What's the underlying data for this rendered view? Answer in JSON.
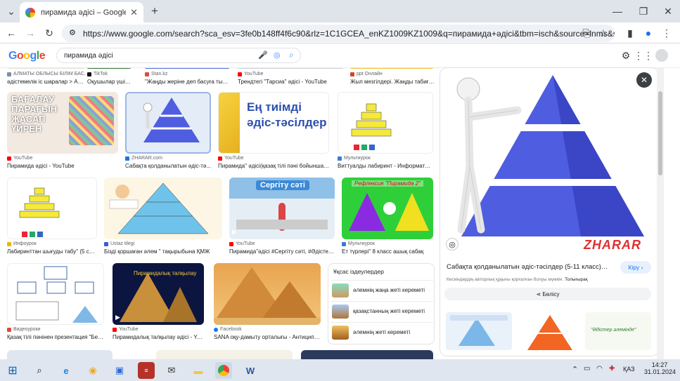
{
  "browser": {
    "tab_title": "пирамида әдісі – Google Search",
    "url": "https://www.google.com/search?sca_esv=3fe0b148ff4f6c90&rlz=1C1GCEA_enKZ1009KZ1009&q=пирамида+әдісі&tbm=isch&source=lnms&sa=X&..."
  },
  "google": {
    "logo": "Google",
    "query": "пирамида әдісі"
  },
  "top_row": [
    {
      "source": "АЛМАТЫ ОБЛЫСЫ БІЛІМ БАС...",
      "title": "әдістемелік іс шаралар > АЛ..."
    },
    {
      "source": "TikTok",
      "title": "Оқушылар үшін қ..."
    },
    {
      "source": "Stan.kz",
      "title": "\"Жаңды жеріне деп басуға тыры..."
    },
    {
      "source": "YouTube",
      "title": "Трендтегі \"Тарсиа\" әдісі - YouTube"
    },
    {
      "source": "ppt Онлайн",
      "title": "Жыл мезгілдері. Жаңды табиғат ..."
    }
  ],
  "cards": [
    {
      "source": "YouTube",
      "title": "Пирамида әдісі - YouTube",
      "thumb_text": [
        "БАҒАЛАУ",
        "ПАРАҒЫН",
        "ЖАСАП",
        "ҮЙРЕН"
      ]
    },
    {
      "source": "ZHARAR.com",
      "title": "Сабақта қолданылатын әдіс-тә..."
    },
    {
      "source": "YouTube",
      "title": "Пирамида\" әдісі(қазақ тілі пәні бойынша).Тре...",
      "thumb_text": [
        "Ең тиімді",
        "әдіс-тәсілдер"
      ]
    },
    {
      "source": "Мультиурок",
      "title": "Виттуалды лабиринт - Информатика - ..."
    },
    {
      "source": "Инфоурок",
      "title": "Лабиринттан шығуды табу\" (5 сын..."
    },
    {
      "source": "Ustaz tilegi",
      "title": "Біздi қоршаған әлем \" тақырыбына ҚМЖ"
    },
    {
      "source": "YouTube",
      "title": "Пирамида\"әдісі #Сергіту сәті, #Әдістер, #...",
      "thumb_text": [
        "Сергіту сәті"
      ]
    },
    {
      "source": "Мультиурок",
      "title": "Ет түрлері\" 8 класс ашық сабақ",
      "thumb_text": [
        "Рефлексия \"Пирамида 2\""
      ]
    },
    {
      "source": "Видеоуроки",
      "title": "Қазақ тілі пәнінен презентация \"Бейте..."
    },
    {
      "source": "YouTube",
      "title": "Пирамидалық талқылау әдісі - YouTu...",
      "thumb_text": [
        "Пирамидалық талқылау"
      ]
    },
    {
      "source": "Facebook",
      "title": "SANA оқу-дамыту орталығы - Антиципаци..."
    }
  ],
  "related": {
    "heading": "Ұқсас іздеулердер",
    "items": [
      "әлемнің жаңа жеті кереметі",
      "қазақстанның жеті кереметі",
      "әлемнің жеті кереметі"
    ]
  },
  "panel": {
    "title": "Сабақта қолданылатын әдіс-тәсілдер (5-11 класс) - kz",
    "view_button": "Кіру",
    "share_button": "Бөлісу",
    "copyright": "Кескіндердің авторлық құқығы қорғалған болуы мүмкін.",
    "more_link": "Толығырақ",
    "watermark": "ZHARAR",
    "thumb_label": "\"Әдістер әлемінде\""
  },
  "taskbar": {
    "time": "14:27",
    "date": "31.01.2024",
    "lang": "ҚАЗ"
  },
  "colors": {
    "pyramid": "#4f5de0",
    "accent": "#1a73e8"
  }
}
